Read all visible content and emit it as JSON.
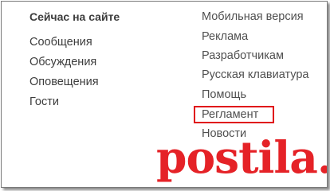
{
  "online_section": {
    "heading": "Сейчас на сайте",
    "links": [
      "Сообщения",
      "Обсуждения",
      "Оповещения",
      "Гости"
    ]
  },
  "service_links": [
    "Мобильная версия",
    "Реклама",
    "Разработчикам",
    "Русская клавиатура",
    "Помощь",
    "Регламент",
    "Новости"
  ],
  "highlighted_link": "Регламент",
  "highlight_color": "#e0101a",
  "watermark": {
    "text": "postila.ru",
    "color": "#e52227"
  }
}
